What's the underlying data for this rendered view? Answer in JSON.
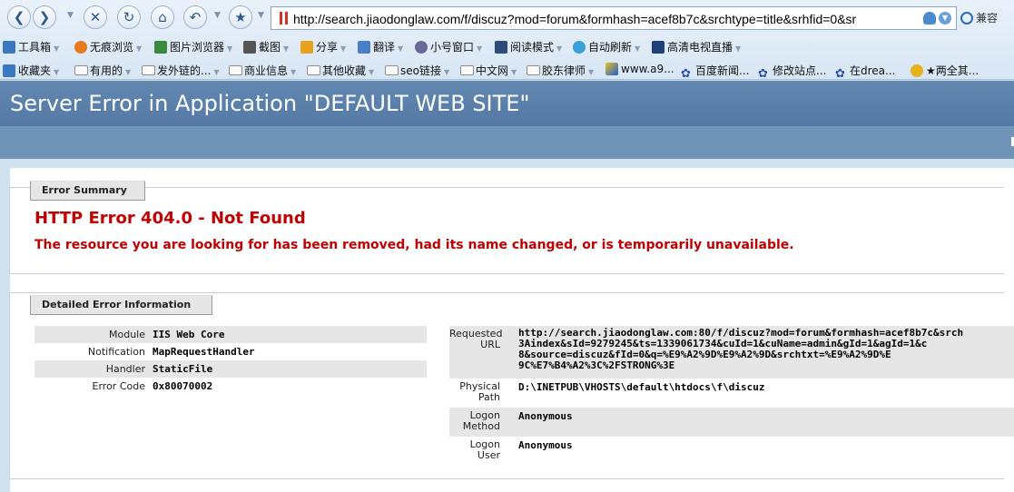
{
  "browser": {
    "address_url": "http://search.jiaodonglaw.com/f/discuz?mod=forum&formhash=acef8b7c&srchtype=title&srhfid=0&sr",
    "compat_label": "兼容",
    "nav": {
      "back_icon": "back-arrow-icon",
      "forward_icon": "forward-arrow-icon"
    },
    "toolbar": [
      "工具箱",
      "无痕浏览",
      "图片浏览器",
      "截图",
      "分享",
      "翻译",
      "小号窗口",
      "阅读模式",
      "自动刷新",
      "高清电视直播"
    ],
    "favorites": [
      "收藏夹",
      "有用的",
      "发外链的...",
      "商业信息",
      "其他收藏",
      "seo链接",
      "中文网",
      "胶东律师",
      "www.a9...",
      "百度新闻...",
      "修改站点...",
      "在drea...",
      "★两全其..."
    ]
  },
  "page": {
    "title": "Server Error in Application \"DEFAULT WEB SITE\"",
    "summary": {
      "legend": "Error Summary",
      "heading": "HTTP Error 404.0 - Not Found",
      "message": "The resource you are looking for has been removed, had its name changed, or is temporarily unavailable."
    },
    "details": {
      "legend": "Detailed Error Information",
      "left": [
        {
          "key": "Module",
          "value": "IIS Web Core"
        },
        {
          "key": "Notification",
          "value": "MapRequestHandler"
        },
        {
          "key": "Handler",
          "value": "StaticFile"
        },
        {
          "key": "Error Code",
          "value": "0x80070002"
        }
      ],
      "right": {
        "requested_url_key_1": "Requested",
        "requested_url_key_2": "URL",
        "requested_url_lines": [
          "http://search.jiaodonglaw.com:80/f/discuz?mod=forum&formhash=acef8b7c&srch",
          "3Aindex&sId=9279245&ts=1339061734&cuId=1&cuName=admin&gId=1&agId=1&c",
          "8&source=discuz&fId=0&q=%E9%A2%9D%E9%A2%9D&srchtxt=%E9%A2%9D%E",
          "9C%E7%B4%A2%3C%2FSTRONG%3E"
        ],
        "physical_path_key_1": "Physical",
        "physical_path_key_2": "Path",
        "physical_path": "D:\\INETPUB\\VHOSTS\\default\\htdocs\\f\\discuz",
        "logon_method_key_1": "Logon",
        "logon_method_key_2": "Method",
        "logon_method": "Anonymous",
        "logon_user_key_1": "Logon",
        "logon_user_key_2": "User",
        "logon_user": "Anonymous"
      }
    }
  }
}
